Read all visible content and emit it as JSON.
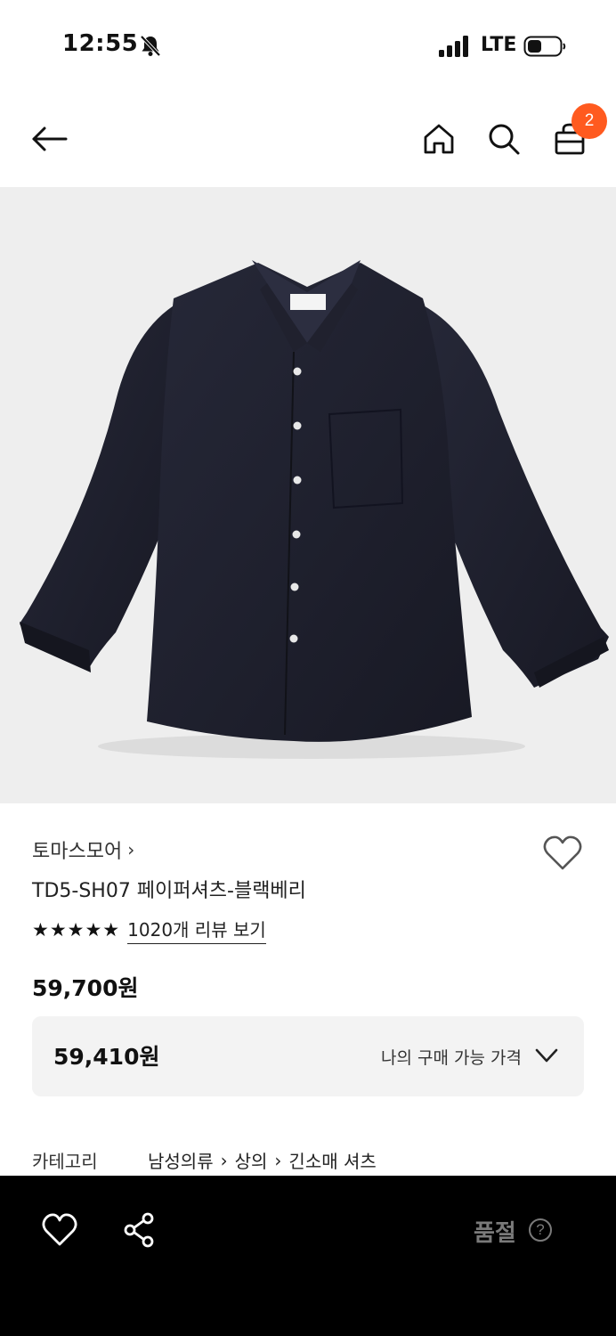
{
  "status_bar": {
    "time": "12:55",
    "network": "LTE"
  },
  "header": {
    "cart_count": "2"
  },
  "product": {
    "brand": "토마스모어",
    "name": "TD5-SH07 페이퍼셔츠-블랙베리",
    "rating_stars": "★★★★★",
    "review_link": "1020개 리뷰 보기",
    "price": "59,700원",
    "my_price": {
      "value": "59,410원",
      "label": "나의 구매 가능 가격"
    },
    "category": {
      "key": "카테고리",
      "path": [
        "남성의류",
        "상의",
        "긴소매 셔츠"
      ]
    }
  },
  "bottom_bar": {
    "status_label": "품절",
    "help_symbol": "?"
  },
  "colors": {
    "badge": "#ff5a1f",
    "image_bg": "#eeeeee",
    "shirt": "#1e1f2c",
    "bottom_bar": "#000000"
  }
}
